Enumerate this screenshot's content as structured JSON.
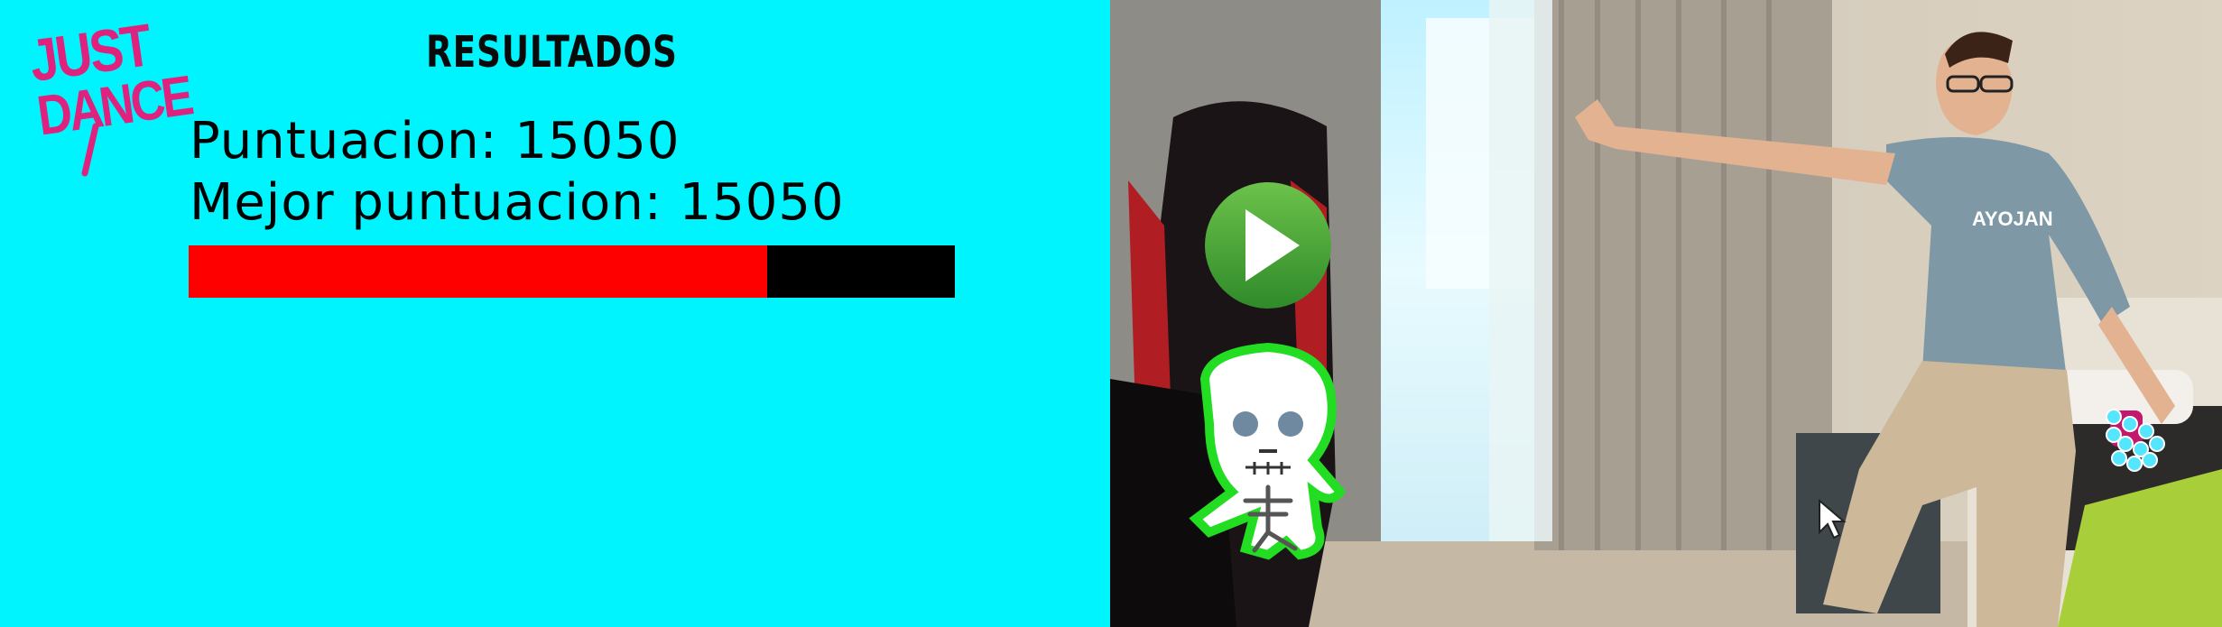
{
  "app": {
    "logo_text_line1": "JUST",
    "logo_text_line2": "DANCE",
    "logo_color": "#e0227f"
  },
  "results": {
    "title": "RESULTADOS",
    "score_label": "Puntuacion:",
    "score_value": "15050",
    "best_label": "Mejor puntuacion:",
    "best_value": "15050",
    "progress_fraction": 0.755,
    "progress_color": "#ff0000",
    "background_color": "#00f4fd"
  },
  "camera": {
    "overlays": {
      "play_button": {
        "icon": "play-icon",
        "color": "#3fa535"
      },
      "dance_character": {
        "icon": "skeleton-dancer-icon",
        "outline_color": "#22dd22"
      },
      "hand_cursor": {
        "icon": "hand-tracking-dots-icon",
        "color": "#55e6ff"
      },
      "mouse_pointer": {
        "icon": "mouse-pointer-icon"
      }
    },
    "shirt_text": "AYOJAN"
  }
}
